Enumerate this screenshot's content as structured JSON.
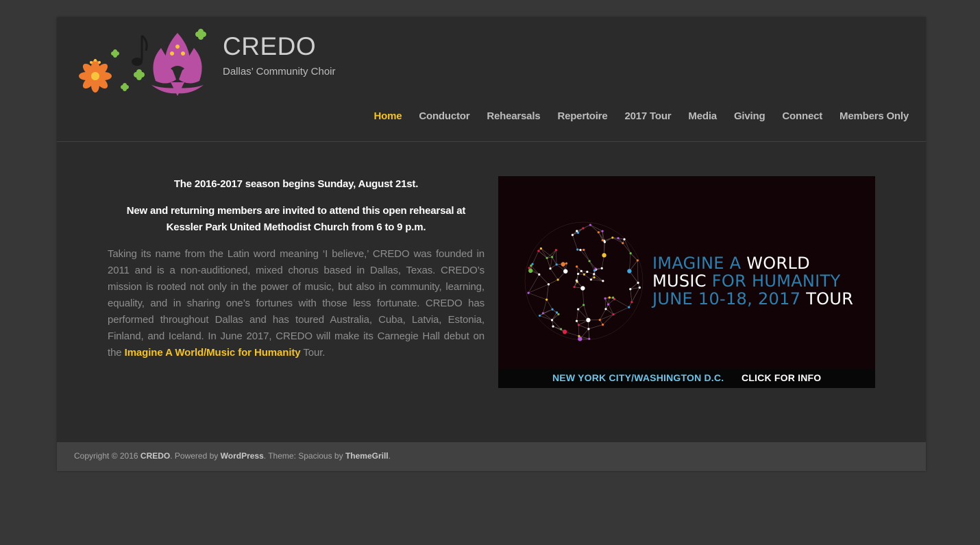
{
  "site": {
    "title": "CREDO",
    "tagline": "Dallas’ Community Choir"
  },
  "nav": {
    "items": [
      {
        "label": "Home",
        "active": true
      },
      {
        "label": "Conductor"
      },
      {
        "label": "Rehearsals"
      },
      {
        "label": "Repertoire"
      },
      {
        "label": "2017 Tour"
      },
      {
        "label": "Media"
      },
      {
        "label": "Giving"
      },
      {
        "label": "Connect"
      },
      {
        "label": "Members Only"
      }
    ]
  },
  "content": {
    "headline1": "The 2016-2017 season begins Sunday, August 21st.",
    "headline2": "New and returning members are invited to attend this open rehearsal at Kessler Park United Methodist Church from 6 to 9 p.m.",
    "body_before_link": "Taking its name from the Latin word meaning ‘I believe,’ CREDO was founded in 2011 and is a non-auditioned, mixed chorus based in Dallas, Texas. CREDO’s mission is rooted not only in the power of music, but also in community, learning, equality, and in sharing one’s fortunes with those less fortunate. CREDO has performed throughout Dallas and has toured Australia, Cuba, Latvia, Estonia, Finland, and Iceland. In June 2017, CREDO will make its Carnegie Hall debut on the ",
    "body_link": "Imagine A World/Music for Humanity",
    "body_after_link": " Tour."
  },
  "banner": {
    "line1_a": "IMAGINE A ",
    "line1_b": "WORLD",
    "line2_a": "MUSIC ",
    "line2_b": "FOR HUMANITY",
    "line3_a": "JUNE 10-18, 2017 ",
    "line3_b": "TOUR",
    "footer_left": "NEW YORK CITY/WASHINGTON D.C.",
    "footer_right": "CLICK FOR INFO",
    "colors": {
      "blue": "#2d7fb0",
      "light_blue": "#6fc3e6",
      "background": "#120406"
    }
  },
  "footer": {
    "copyright_prefix": "Copyright © 2016 ",
    "site_link": "CREDO",
    "powered": ". Powered by ",
    "wp_link": "WordPress",
    "theme_text": ". Theme: Spacious by ",
    "theme_link": "ThemeGrill",
    "end": "."
  },
  "colors": {
    "accent": "#f5c324",
    "page_bg": "#373737",
    "wrapper_bg": "#2b2b2b",
    "footer_bg": "#414141"
  },
  "icons": {
    "logo": "choir-logo-flowers-music-note"
  }
}
